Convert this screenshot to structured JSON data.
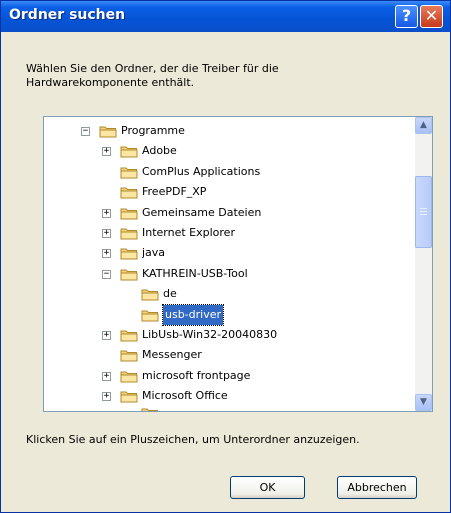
{
  "window": {
    "title": "Ordner suchen",
    "help_symbol": "?",
    "close_symbol": "✕"
  },
  "description": "Wählen Sie den Ordner, der die Treiber für die Hardwarekomponente enthält.",
  "tree": {
    "items": [
      {
        "label": "Programme",
        "expander": "minus"
      },
      {
        "label": "Adobe",
        "expander": "plus"
      },
      {
        "label": "ComPlus Applications",
        "expander": "none"
      },
      {
        "label": "FreePDF_XP",
        "expander": "none"
      },
      {
        "label": "Gemeinsame Dateien",
        "expander": "plus"
      },
      {
        "label": "Internet Explorer",
        "expander": "plus"
      },
      {
        "label": "java",
        "expander": "plus"
      },
      {
        "label": "KATHREIN-USB-Tool",
        "expander": "minus"
      },
      {
        "label": "de",
        "expander": "none"
      },
      {
        "label": "usb-driver",
        "expander": "none",
        "selected": true
      },
      {
        "label": "LibUsb-Win32-20040830",
        "expander": "plus"
      },
      {
        "label": "Messenger",
        "expander": "none"
      },
      {
        "label": "microsoft frontpage",
        "expander": "plus"
      },
      {
        "label": "Microsoft Office",
        "expander": "plus"
      }
    ],
    "scroll_up": "▲",
    "scroll_down": "▼"
  },
  "hint": "Klicken Sie auf ein Pluszeichen, um Unterordner anzuzeigen.",
  "buttons": {
    "ok": "OK",
    "cancel": "Abbrechen"
  },
  "colors": {
    "title_bar": "#0554d6",
    "selection": "#316ac5",
    "folder": "#f4d37a"
  }
}
